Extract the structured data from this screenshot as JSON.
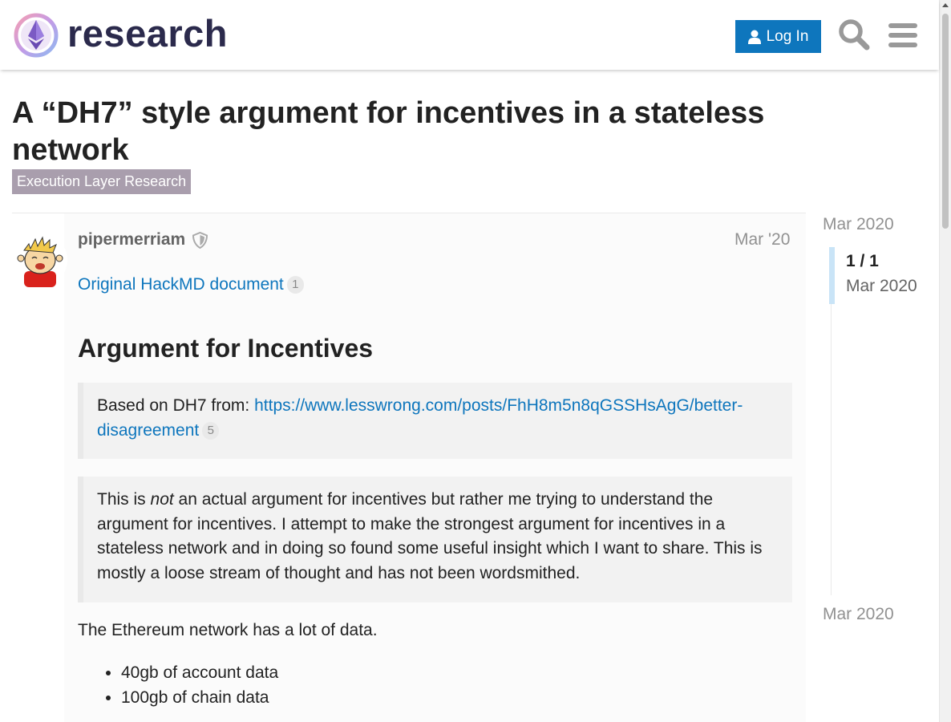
{
  "header": {
    "site_name": "research",
    "login_label": "Log In",
    "icons": {
      "login": "user-icon",
      "search": "search-icon",
      "menu": "hamburger-menu-icon"
    },
    "colors": {
      "accent": "#0e76bd",
      "brand_text": "#2b2a4c"
    }
  },
  "topic": {
    "title": "A “DH7” style argument for incentives in a stateless network",
    "category": "Execution Layer Research",
    "category_color": "#a99ead"
  },
  "post": {
    "username": "pipermerriam",
    "user_badge_icon": "shield-icon",
    "date": "Mar '20",
    "link_text": "Original HackMD document",
    "link_clicks": "1",
    "heading": "Argument for Incentives",
    "quote1_prefix": "Based on DH7 from: ",
    "quote1_link_part1": "https://www.lesswrong.com/posts/FhH8m5n8qGSSHsAgG/better-",
    "quote1_link_part2": "disagreement",
    "quote1_link_clicks": "5",
    "quote2_pre": "This is ",
    "quote2_em": "not",
    "quote2_post": " an actual argument for incentives but rather me trying to understand the argument for incentives. I attempt to make the strongest argument for incentives in a stateless network and in doing so found some useful insight which I want to share. This is mostly a loose stream of thought and has not been wordsmithed.",
    "paragraph1": "The Ethereum network has a lot of data.",
    "list_items": [
      "40gb of account data",
      "100gb of chain data"
    ]
  },
  "timeline": {
    "start_date": "Mar 2020",
    "position": "1 / 1",
    "position_date": "Mar 2020",
    "end_date": "Mar 2020"
  }
}
